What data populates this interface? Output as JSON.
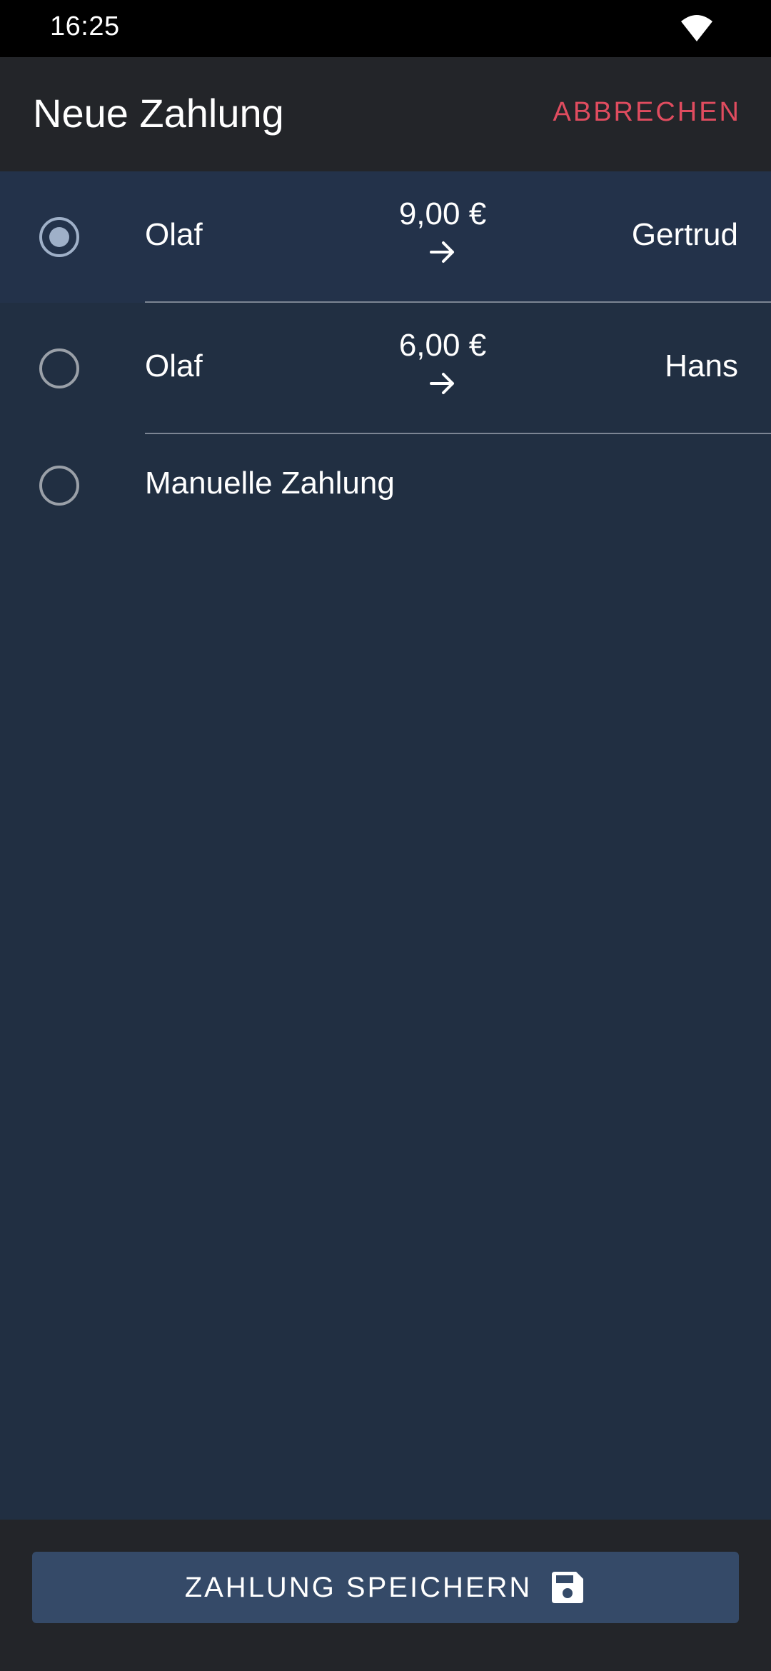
{
  "status_bar": {
    "time": "16:25",
    "wifi_icon": "wifi-icon"
  },
  "app_bar": {
    "title": "Neue Zahlung",
    "cancel_label": "ABBRECHEN",
    "cancel_color": "#e04c5f"
  },
  "payments": [
    {
      "from": "Olaf",
      "amount": "9,00 €",
      "to": "Gertrud",
      "selected": true
    },
    {
      "from": "Olaf",
      "amount": "6,00 €",
      "to": "Hans",
      "selected": false
    }
  ],
  "manual_payment": {
    "label": "Manuelle Zahlung",
    "selected": false
  },
  "save_button": {
    "label": "ZAHLUNG SPEICHERN",
    "icon": "floppy-disk-icon"
  },
  "colors": {
    "background": "#212f42",
    "bar": "#232529",
    "button": "#354a68",
    "accent": "#e04c5f"
  }
}
